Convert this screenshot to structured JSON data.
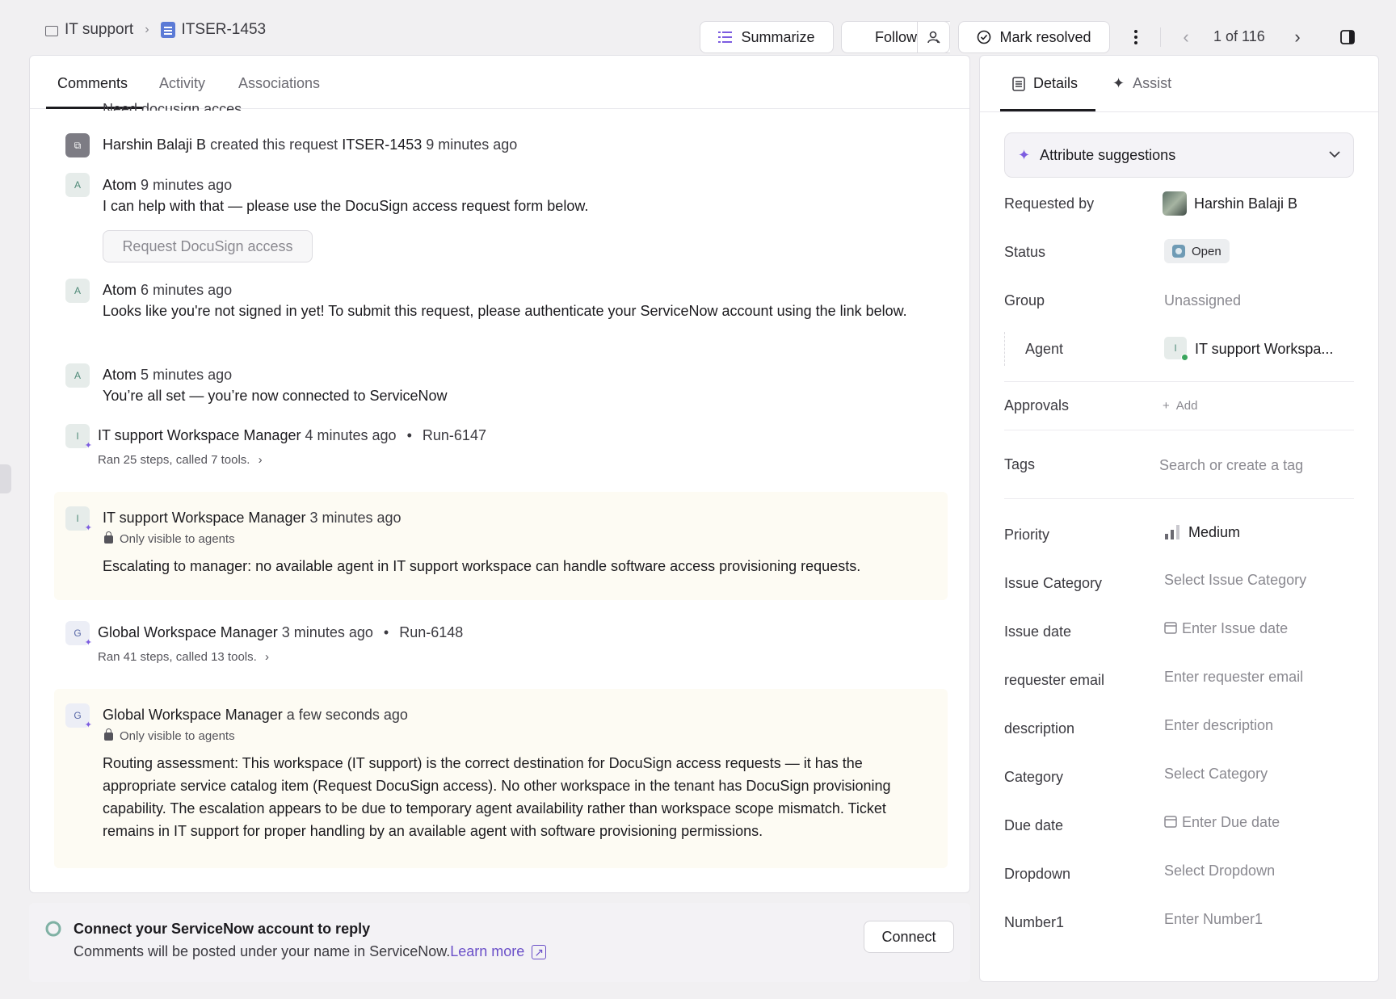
{
  "breadcrumb": {
    "workspace": "IT support",
    "ticket_id": "ITSER-1453"
  },
  "toolbar": {
    "summarize_label": "Summarize",
    "follow_label": "Follow",
    "mark_resolved_label": "Mark resolved",
    "pager": "1 of 116"
  },
  "tabs": {
    "comments": "Comments",
    "activity": "Activity",
    "associations": "Associations"
  },
  "feed": {
    "clipped_text": "Need docusign acces",
    "created": {
      "actor": "Harshin Balaji B",
      "text": "created this request",
      "ticket": "ITSER-1453",
      "time": "9 minutes ago"
    },
    "msg1": {
      "avatar": "A",
      "author": "Atom",
      "time": "9 minutes ago",
      "body": "I can help with that — please use the DocuSign access request form below.",
      "button": "Request DocuSign access"
    },
    "msg2": {
      "avatar": "A",
      "author": "Atom",
      "time": "6 minutes ago",
      "body": "Looks like you're not signed in yet! To submit this request, please authenticate your ServiceNow account using the link below."
    },
    "msg3": {
      "avatar": "A",
      "author": "Atom",
      "time": "5 minutes ago",
      "body": "You’re all set — you’re now connected to ServiceNow"
    },
    "run1": {
      "avatar": "I",
      "author": "IT support Workspace Manager",
      "time": "4 minutes ago",
      "run": "Run-6147",
      "summary": "Ran 25 steps, called 7 tools."
    },
    "note1": {
      "avatar": "I",
      "author": "IT support Workspace Manager",
      "time": "3 minutes ago",
      "visibility": "Only visible to agents",
      "body": "Escalating to manager: no available agent in IT support workspace can handle software access provisioning requests."
    },
    "run2": {
      "avatar": "G",
      "author": "Global Workspace Manager",
      "time": "3 minutes ago",
      "run": "Run-6148",
      "summary": "Ran 41 steps, called 13 tools."
    },
    "note2": {
      "avatar": "G",
      "author": "Global Workspace Manager",
      "time": "a few seconds ago",
      "visibility": "Only visible to agents",
      "body": "Routing assessment: This workspace (IT support) is the correct destination for DocuSign access requests — it has the appropriate service catalog item (Request DocuSign access). No other workspace in the tenant has DocuSign provisioning capability. The escalation appears to be due to temporary agent availability rather than workspace scope mismatch. Ticket remains in IT support for proper handling by an available agent with software provisioning permissions."
    }
  },
  "reply_bar": {
    "title": "Connect your ServiceNow account to reply",
    "subtitle": "Comments will be posted under your name in ServiceNow.",
    "learn_more": "Learn more",
    "connect_label": "Connect"
  },
  "details": {
    "tab_details": "Details",
    "tab_assist": "Assist",
    "suggestions": "Attribute suggestions",
    "fields": {
      "requested_by": {
        "label": "Requested by",
        "value": "Harshin Balaji B"
      },
      "status": {
        "label": "Status",
        "value": "Open"
      },
      "group": {
        "label": "Group",
        "value": "Unassigned"
      },
      "agent": {
        "label": "Agent",
        "value": "IT support Workspa...",
        "avatar": "I"
      },
      "approvals": {
        "label": "Approvals",
        "value": "Add"
      },
      "tags": {
        "label": "Tags",
        "value": "Search or create a tag"
      },
      "priority": {
        "label": "Priority",
        "value": "Medium"
      },
      "issue_category": {
        "label": "Issue Category",
        "value": "Select Issue Category"
      },
      "issue_date": {
        "label": "Issue date",
        "value": "Enter Issue date"
      },
      "requester_email": {
        "label": "requester email",
        "value": "Enter requester email"
      },
      "description": {
        "label": "description",
        "value": "Enter description"
      },
      "category": {
        "label": "Category",
        "value": "Select Category"
      },
      "due_date": {
        "label": "Due date",
        "value": "Enter Due date"
      },
      "dropdown": {
        "label": "Dropdown",
        "value": "Select Dropdown"
      },
      "number1": {
        "label": "Number1",
        "value": "Enter Number1"
      }
    }
  },
  "colors": {
    "accent_purple": "#7c5ce0",
    "note_bg": "#fdfbf3",
    "link": "#6a4fc8",
    "online_green": "#3aa55d"
  }
}
